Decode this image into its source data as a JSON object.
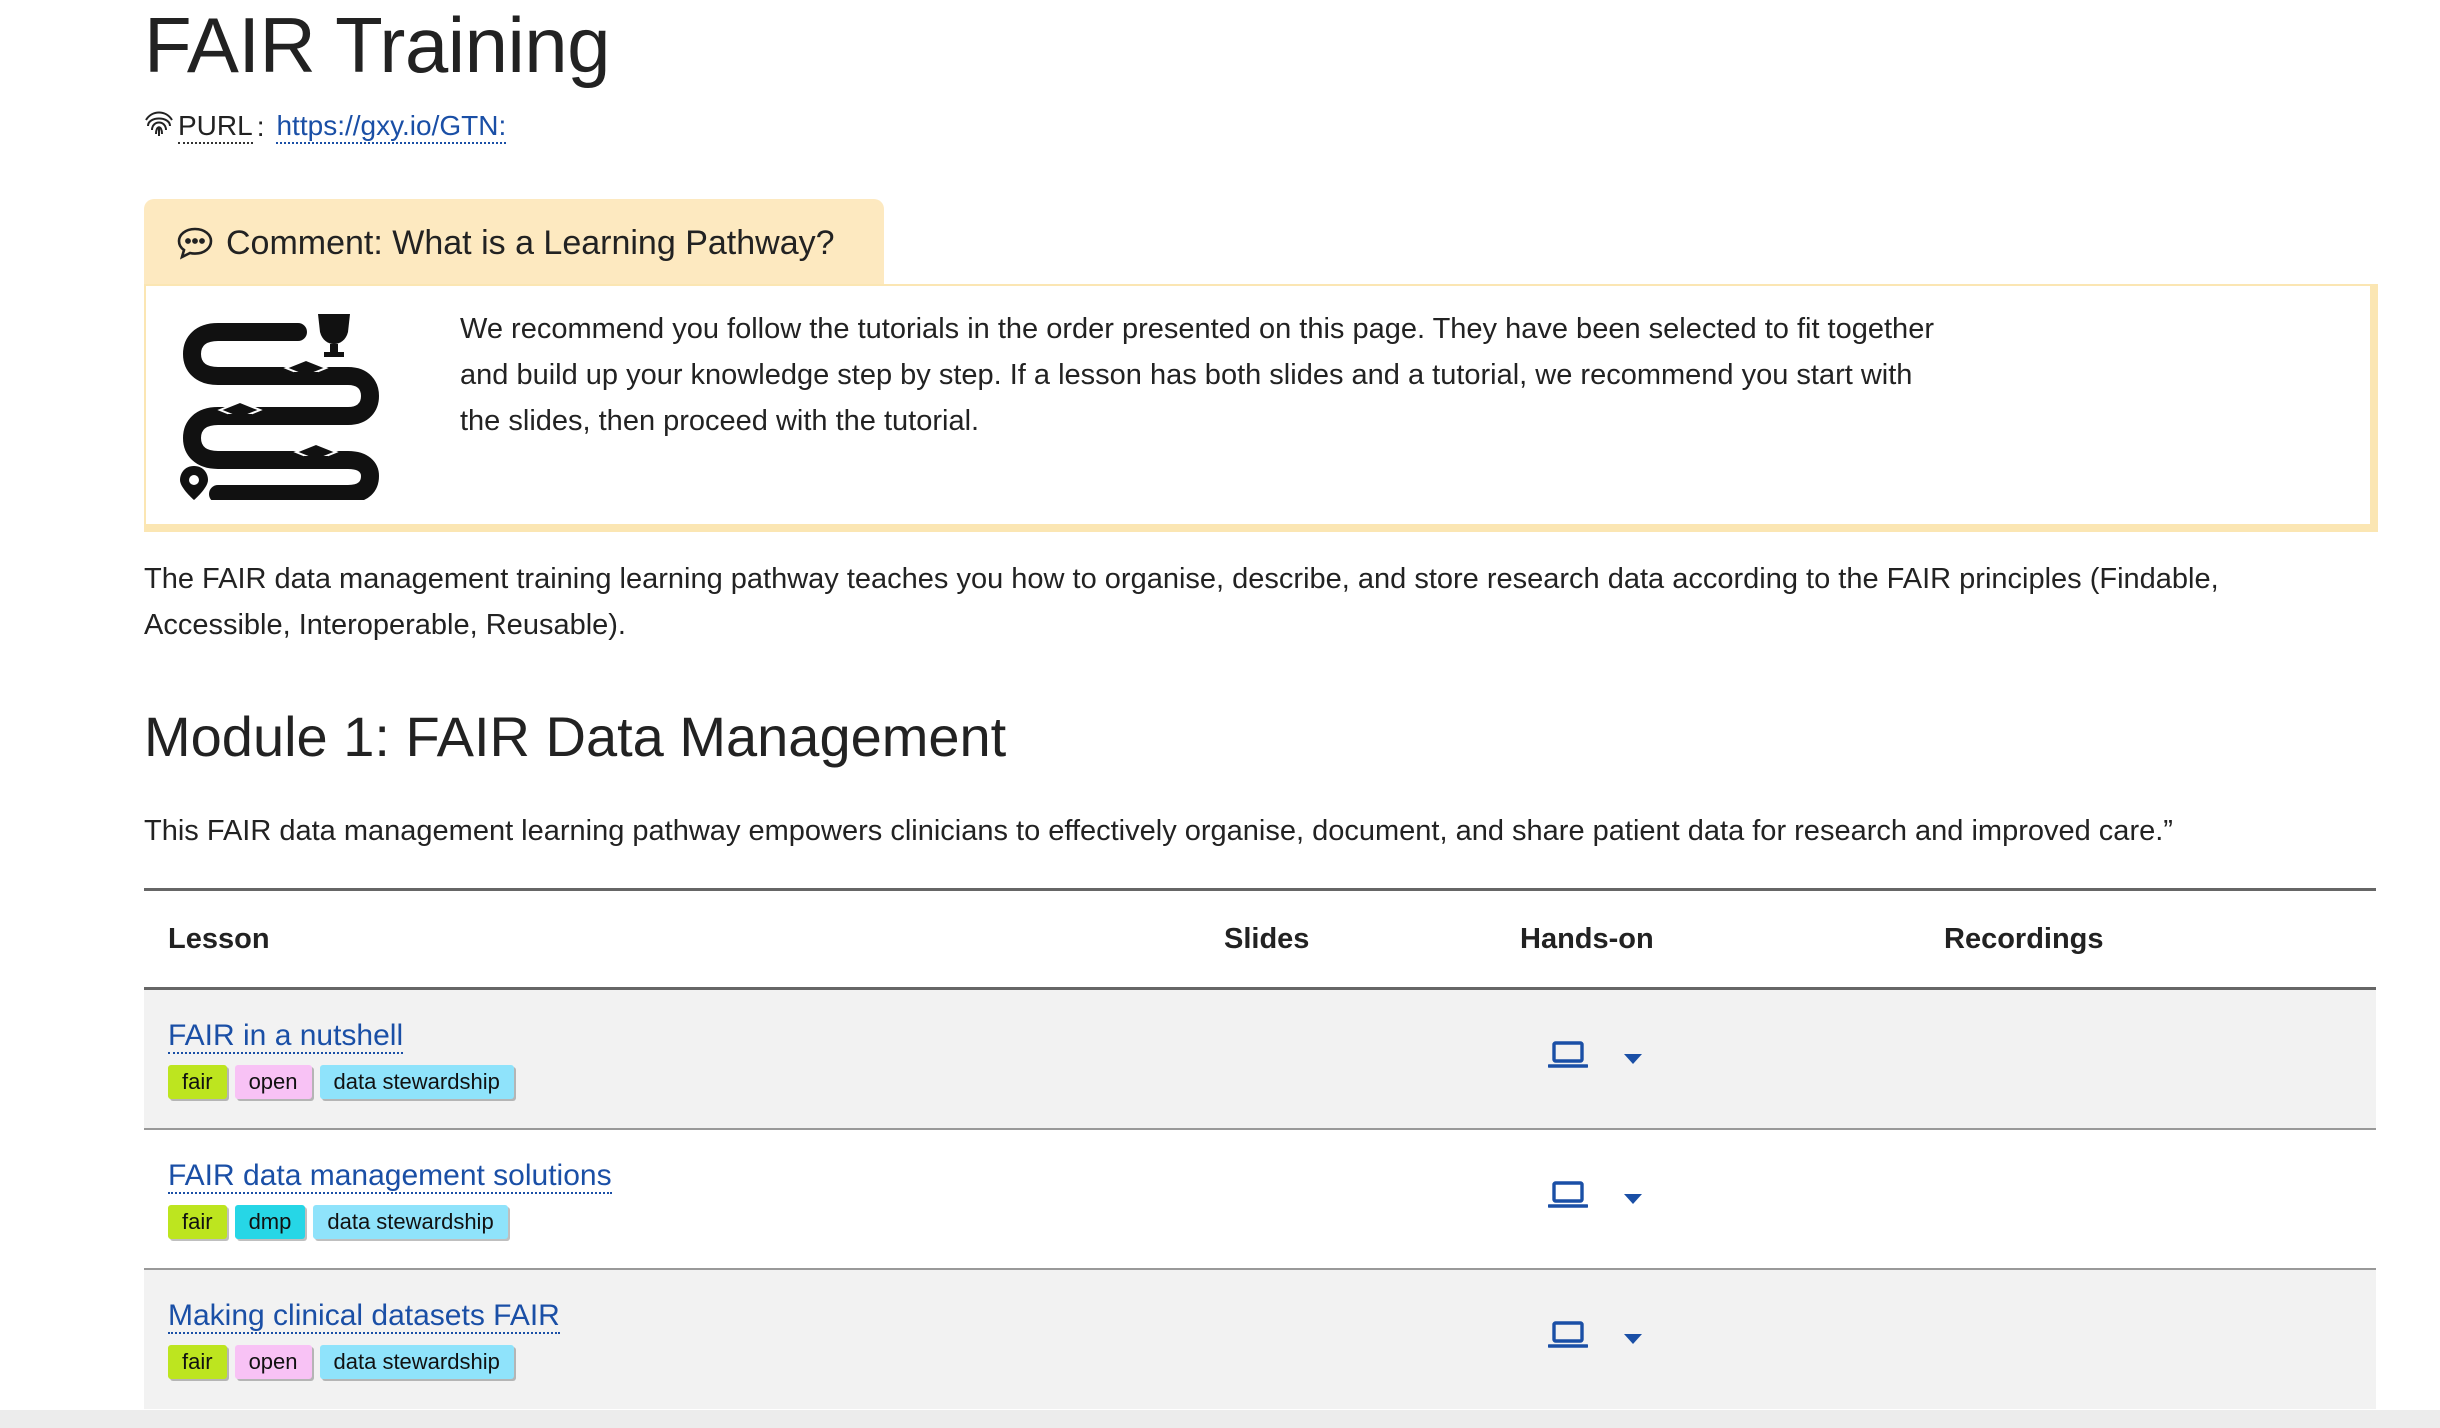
{
  "page": {
    "title": "FAIR Training",
    "purl_label": "PURL",
    "purl_sep": ":",
    "purl_url": "https://gxy.io/GTN:"
  },
  "comment": {
    "title": "Comment: What is a Learning Pathway?",
    "body": "We recommend you follow the tutorials in the order presented on this page. They have been selected to fit together and build up your knowledge step by step. If a lesson has both slides and a tutorial, we recommend you start with the slides, then proceed with the tutorial."
  },
  "intro": "The FAIR data management training learning pathway teaches you how to organise, describe, and store research data according to the FAIR principles (Findable, Accessible, Interoperable, Reusable).",
  "module": {
    "title": "Module 1: FAIR Data Management",
    "description": "This FAIR data management learning pathway empowers clinicians to effectively organise, document, and share patient data for research and improved care.”"
  },
  "table": {
    "headers": {
      "lesson": "Lesson",
      "slides": "Slides",
      "handson": "Hands-on",
      "recordings": "Recordings"
    },
    "rows": [
      {
        "title": "FAIR in a nutshell",
        "tags": [
          "fair",
          "open",
          "data stewardship"
        ]
      },
      {
        "title": "FAIR data management solutions",
        "tags": [
          "fair",
          "dmp",
          "data stewardship"
        ]
      },
      {
        "title": "Making clinical datasets FAIR",
        "tags": [
          "fair",
          "open",
          "data stewardship"
        ]
      }
    ]
  },
  "icons": {
    "purl": "fingerprint-icon",
    "comment": "comment-icon",
    "pathway": "learning-pathway-icon",
    "handson": "laptop-icon",
    "dropdown": "caret-down-icon"
  },
  "colors": {
    "link": "#1a4fa6",
    "comment_header": "#fde9c0",
    "tag_fair": "#bde51f",
    "tag_open": "#f8c2f5",
    "tag_data_stewardship": "#8fe3fb",
    "tag_dmp": "#26d6e6"
  }
}
